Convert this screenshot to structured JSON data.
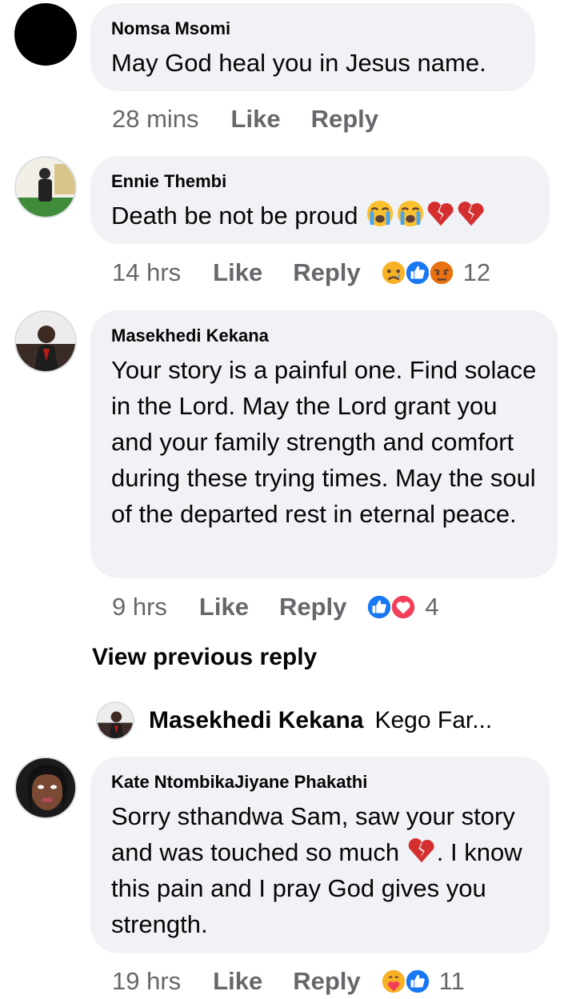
{
  "comments": [
    {
      "author": "Nomsa Msomi",
      "text": "May God heal you in Jesus name.",
      "time": "28 mins",
      "like_label": "Like",
      "reply_label": "Reply",
      "reaction_count": ""
    },
    {
      "author": "Ennie Thembi",
      "text": "Death be not be proud",
      "text_emojis": [
        "loudly-crying-face",
        "loudly-crying-face",
        "broken-heart",
        "broken-heart"
      ],
      "time": "14 hrs",
      "like_label": "Like",
      "reply_label": "Reply",
      "reactions": [
        "sad",
        "like",
        "angry"
      ],
      "reaction_count": "12"
    },
    {
      "author": "Masekhedi Kekana",
      "text": "Your story is a painful one. Find solace in the Lord. May the Lord grant you and your family strength and comfort during these trying times. May the soul of the departed rest in eternal peace.",
      "time": "9 hrs",
      "like_label": "Like",
      "reply_label": "Reply",
      "reactions": [
        "like",
        "love"
      ],
      "reaction_count": "4"
    },
    {
      "author": "Kate NtombikaJiyane Phakathi",
      "text_before": "Sorry sthandwa Sam, saw your story and was touched so much ",
      "text_after": ". I know this pain and I pray God gives you strength.",
      "text_emojis": [
        "broken-heart"
      ],
      "time": "19 hrs",
      "like_label": "Like",
      "reply_label": "Reply",
      "reactions": [
        "care",
        "like"
      ],
      "reaction_count": "11"
    }
  ],
  "view_previous_reply": "View previous reply",
  "reply_preview": {
    "author": "Masekhedi Kekana",
    "snippet": "Kego Far..."
  },
  "colors": {
    "bubble": "#f0f2f5",
    "meta_text": "#65676b",
    "like_blue": "#1877f2",
    "love_red": "#f33e58",
    "reaction_yellow": "#f7b125"
  }
}
